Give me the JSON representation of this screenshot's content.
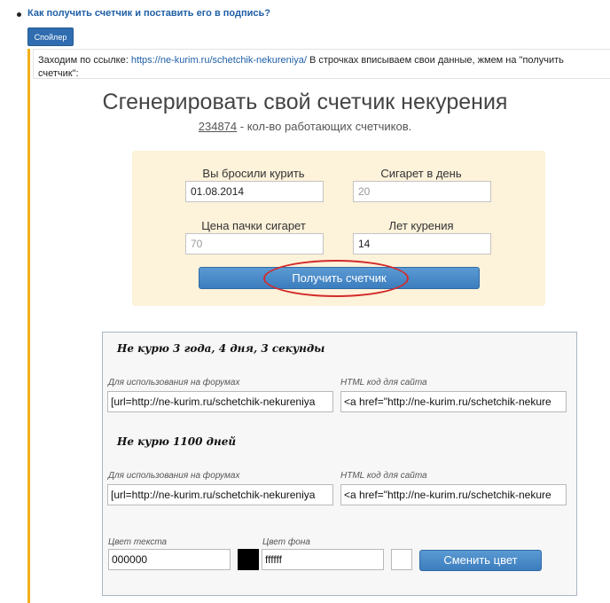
{
  "header": {
    "link_text": "Как получить счетчик и поставить его в подпись?",
    "spoiler_label": "Спойлер"
  },
  "intro": {
    "before": "Заходим по ссылке: ",
    "url": "https://ne-kurim.ru/schetchik-nekureniya/",
    "after": " В строчках вписываем свои данные, жмем на \"получить счетчик\":"
  },
  "generator": {
    "title": "Сгенерировать свой счетчик некурения",
    "counter_value": "234874",
    "counter_suffix": " - кол-во работающих счетчиков.",
    "fields": {
      "quit_date_label": "Вы бросили курить",
      "quit_date_value": "01.08.2014",
      "per_day_label": "Сигарет в день",
      "per_day_placeholder": "20",
      "pack_price_label": "Цена пачки сигарет",
      "pack_price_placeholder": "70",
      "years_label": "Лет курения",
      "years_value": "14"
    },
    "submit_label": "Получить счетчик"
  },
  "result": {
    "counter1_text": "Не курю  3 года, 4 дня, 3 секунды",
    "counter2_text": "Не курю  1100 дней",
    "forum_label": "Для использования на форумах",
    "html_label": "HTML код для сайта",
    "forum_code": "[url=http://ne-kurim.ru/schetchik-nekureniya",
    "html_code": "<a href=\"http://ne-kurim.ru/schetchik-nekure",
    "text_color_label": "Цвет текста",
    "text_color_value": "000000",
    "bg_color_label": "Цвет фона",
    "bg_color_value": "ffffff",
    "change_color_label": "Сменить цвет"
  },
  "colors": {
    "link": "#1f5fa6",
    "spoiler_accent": "#f2b01a",
    "button_blue": "#3c7dbf",
    "form_bg": "#fdf2da",
    "highlight_red": "#d22b2b",
    "text_swatch": "#000000",
    "bg_swatch": "#ffffff"
  }
}
